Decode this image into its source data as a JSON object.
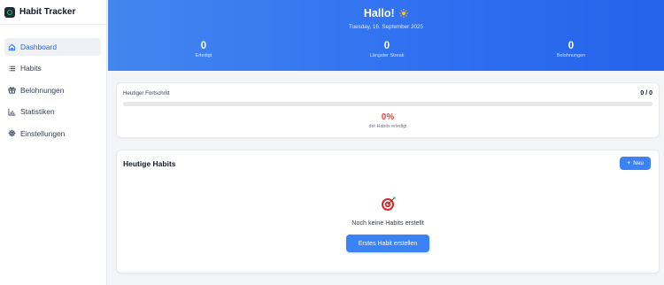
{
  "app": {
    "title": "Habit Tracker",
    "logo_icon": "habit-tracker-logo"
  },
  "sidebar": {
    "items": [
      {
        "label": "Dashboard",
        "icon": "home-icon",
        "active": true
      },
      {
        "label": "Habits",
        "icon": "list-icon",
        "active": false
      },
      {
        "label": "Belohnungen",
        "icon": "gift-icon",
        "active": false
      },
      {
        "label": "Statistiken",
        "icon": "bar-chart-icon",
        "active": false
      },
      {
        "label": "Einstellungen",
        "icon": "gear-icon",
        "active": false
      }
    ]
  },
  "header": {
    "greeting": "Hallo!",
    "greeting_icon": "sun-icon",
    "date": "Tuesday, 16. September 2025",
    "stats": [
      {
        "value": "0",
        "label": "Erledigt"
      },
      {
        "value": "0",
        "label": "Längster Streak"
      },
      {
        "value": "0",
        "label": "Belohnungen"
      }
    ]
  },
  "progress": {
    "label": "Heutiger Fortschritt",
    "ratio": "0 / 0",
    "fraction": 0,
    "percent": "0%",
    "subtitle": "der Habits erledigt"
  },
  "habits": {
    "title": "Heutige Habits",
    "new_button": "Neu",
    "new_button_icon": "plus-icon",
    "empty_icon": "target-icon",
    "empty_text": "Noch keine Habits erstellt",
    "cta_button": "Erstes Habit erstellen"
  },
  "colors": {
    "accent": "#3b82f6",
    "header_gradient_start": "#4386ef",
    "header_gradient_end": "#2563eb",
    "percent_red": "#ef4444"
  }
}
